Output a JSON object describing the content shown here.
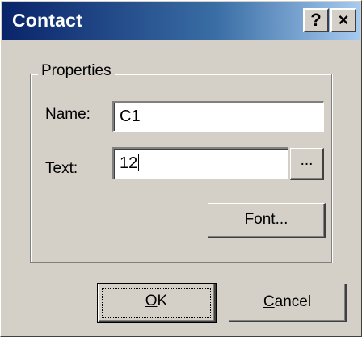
{
  "window": {
    "title": "Contact",
    "help_label": "?",
    "close_label": "×"
  },
  "properties": {
    "group_label": "Properties",
    "name_label": "Name:",
    "name_value": "C1",
    "text_label": "Text:",
    "text_value": "12",
    "browse_label": "...",
    "font_button_label": "Font..."
  },
  "buttons": {
    "ok_label": "OK",
    "cancel_label": "Cancel"
  }
}
